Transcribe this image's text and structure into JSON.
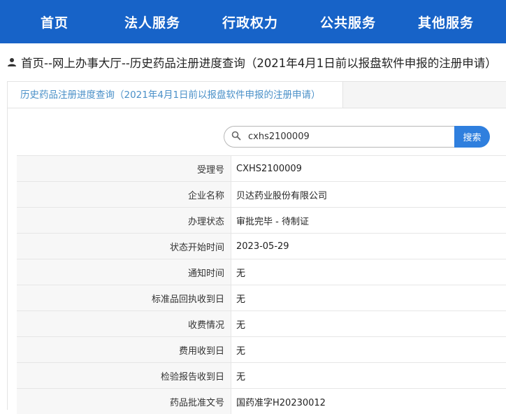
{
  "nav": {
    "items": [
      "首页",
      "法人服务",
      "行政权力",
      "公共服务",
      "其他服务"
    ]
  },
  "breadcrumb": {
    "text": "首页--网上办事大厅--历史药品注册进度查询（2021年4月1日前以报盘软件申报的注册申请）"
  },
  "tab": {
    "label": "历史药品注册进度查询（2021年4月1日前以报盘软件申报的注册申请）"
  },
  "search": {
    "value": "cxhs2100009",
    "button_label": "搜索"
  },
  "rows": [
    {
      "label": "受理号",
      "value": "CXHS2100009"
    },
    {
      "label": "企业名称",
      "value": "贝达药业股份有限公司"
    },
    {
      "label": "办理状态",
      "value": "审批完毕 - 待制证"
    },
    {
      "label": "状态开始时间",
      "value": "2023-05-29"
    },
    {
      "label": "通知时间",
      "value": "无"
    },
    {
      "label": "标准品回执收到日",
      "value": "无"
    },
    {
      "label": "收费情况",
      "value": "无"
    },
    {
      "label": "费用收到日",
      "value": "无"
    },
    {
      "label": "检验报告收到日",
      "value": "无"
    },
    {
      "label": "药品批准文号",
      "value": "国药准字H20230012"
    }
  ],
  "colors": {
    "nav_bg": "#1763c8",
    "tab_text": "#4a90c8",
    "search_button": "#2f7fde"
  },
  "icons": [
    "user-icon",
    "search-icon"
  ]
}
